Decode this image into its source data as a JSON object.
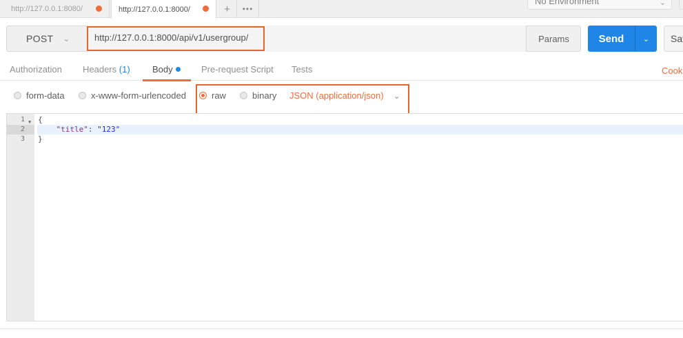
{
  "tabs": [
    {
      "label": "http://127.0.0.1:8080/",
      "active": false
    },
    {
      "label": "http://127.0.0.1:8000/",
      "active": true
    }
  ],
  "tab_add_icon": "+",
  "tab_more_icon": "•••",
  "environment": {
    "label": "No Environment",
    "chevron_icon": "chevron-down-icon"
  },
  "request": {
    "method": "POST",
    "url": "http://127.0.0.1:8000/api/v1/usergroup/",
    "params_label": "Params",
    "send_label": "Send",
    "save_label": "Save"
  },
  "subtabs": {
    "authorization": "Authorization",
    "headers": "Headers",
    "headers_count": "(1)",
    "body": "Body",
    "prerequest": "Pre-request Script",
    "tests": "Tests",
    "cookies": "Cookies"
  },
  "body_types": {
    "form_data": "form-data",
    "urlencoded": "x-www-form-urlencoded",
    "raw": "raw",
    "binary": "binary",
    "selected": "raw",
    "content_type": "JSON (application/json)"
  },
  "editor": {
    "line_numbers": [
      "1",
      "2",
      "3"
    ],
    "lines": {
      "l1": "{",
      "l2_key": "\"title\"",
      "l2_sep": ": ",
      "l2_value": "\"123\"",
      "l3": "}"
    },
    "active_line": 2
  },
  "colors": {
    "accent": "#f26b3a",
    "send_blue": "#1f85e6",
    "highlight_box": "#e8642a"
  }
}
